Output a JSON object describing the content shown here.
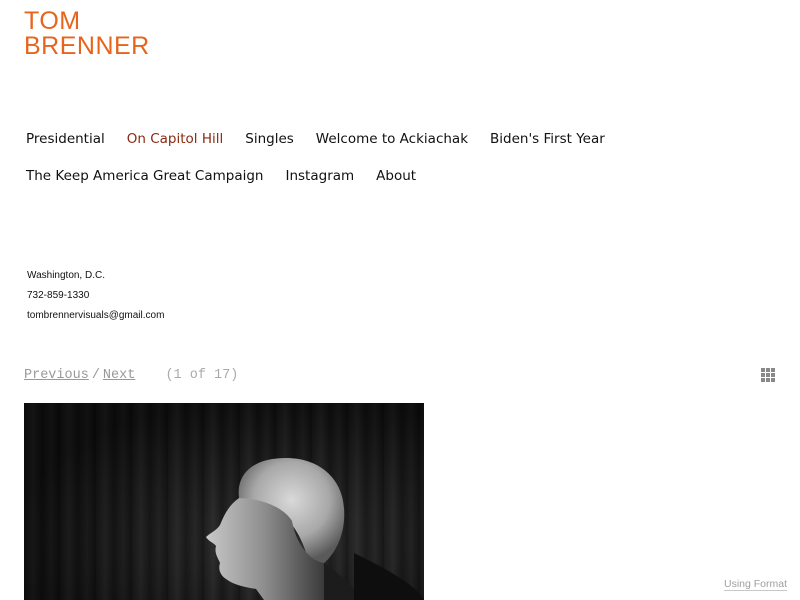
{
  "site": {
    "logo_line1": "TOM",
    "logo_line2": "BRENNER",
    "brand_color": "#e8641c"
  },
  "nav": {
    "active_item": "On Capitol Hill",
    "active_color": "#8a2a10",
    "items": [
      {
        "label": "Presidential"
      },
      {
        "label": "On Capitol Hill"
      },
      {
        "label": "Singles"
      },
      {
        "label": "Welcome to Ackiachak"
      },
      {
        "label": "Biden's First Year"
      },
      {
        "label": "The Keep America Great Campaign"
      },
      {
        "label": "Instagram"
      },
      {
        "label": "About"
      }
    ]
  },
  "contact": {
    "location": "Washington, D.C.",
    "phone": "732-859-1330",
    "email": "tombrennervisuals@gmail.com"
  },
  "pager": {
    "previous_label": "Previous",
    "separator": "/",
    "next_label": "Next",
    "count_label": "(1 of 17)",
    "grid_icon": "grid-icon"
  },
  "gallery": {
    "photo_description": "black-and-white portrait"
  },
  "footer": {
    "using_format_label": "Using Format"
  }
}
